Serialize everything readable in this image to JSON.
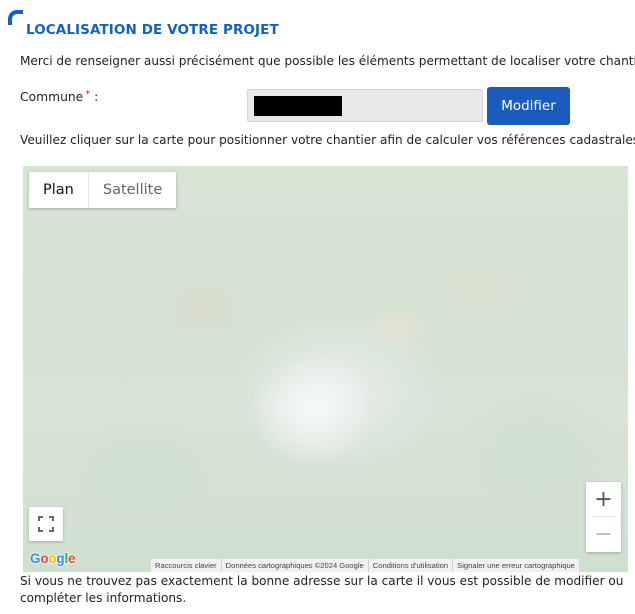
{
  "header": {
    "title": "LOCALISATION DE VOTRE PROJET",
    "accent_color": "#1560bd"
  },
  "intro_text": "Merci de renseigner aussi précisément que possible les éléments permettant de localiser votre chantier.",
  "commune": {
    "label": "Commune",
    "required_marker": "*",
    "label_suffix": " :",
    "value_redacted": true,
    "button_label": "Modifier",
    "button_color": "#1a5bbd"
  },
  "map_instruction": "Veuillez cliquer sur la carte pour positionner votre chantier afin de calculer vos références cadastrales.",
  "map": {
    "type_options": [
      "Plan",
      "Satellite"
    ],
    "selected_type": "Plan",
    "zoom_in": "+",
    "zoom_out": "−",
    "fullscreen_icon": "fullscreen-icon",
    "logo_letters": [
      "G",
      "o",
      "o",
      "g",
      "l",
      "e"
    ],
    "logo_colors": [
      "#4285F4",
      "#EA4335",
      "#FBBC05",
      "#4285F4",
      "#34A853",
      "#EA4335"
    ],
    "attribution": [
      "Raccourcis clavier",
      "Données cartographiques ©2024 Google",
      "Conditions d'utilisation",
      "Signaler une erreur cartographique"
    ]
  },
  "footer_text": "Si vous ne trouvez pas exactement la bonne adresse sur la carte il vous est possible de modifier ou compléter les informations."
}
